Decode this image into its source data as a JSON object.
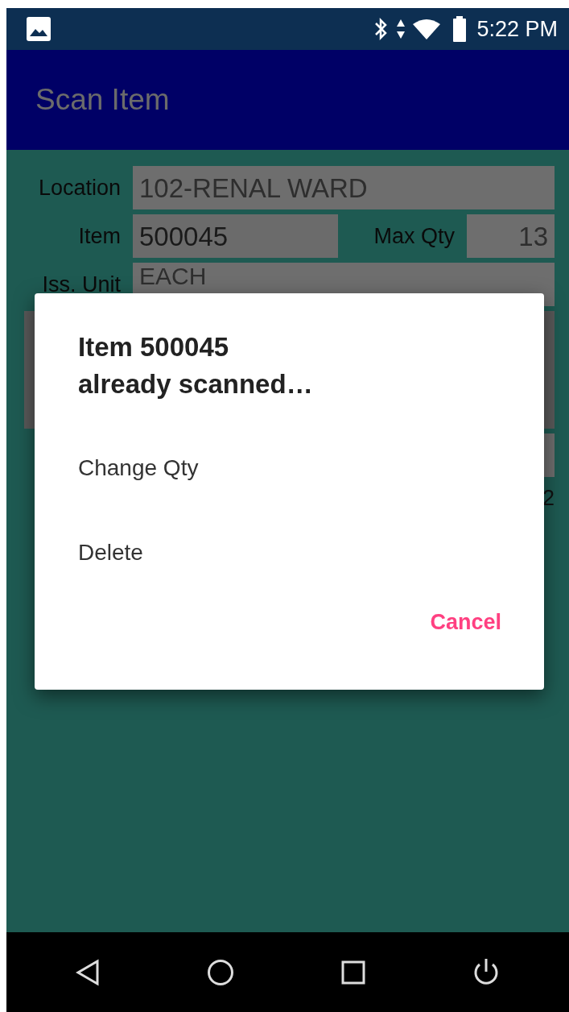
{
  "status_bar": {
    "time": "5:22 PM"
  },
  "app_bar": {
    "title": "Scan Item"
  },
  "form": {
    "location": {
      "label": "Location",
      "value": "102-RENAL WARD",
      "disabled": true
    },
    "item": {
      "label": "Item",
      "value": "500045",
      "disabled": false
    },
    "max_qty": {
      "label": "Max Qty",
      "value": "13",
      "disabled": true
    },
    "iss_unit": {
      "label": "Iss. Unit",
      "value": "EACH",
      "disabled": true
    },
    "column_text": "2"
  },
  "dialog": {
    "title_lines": [
      "Item 500045",
      "already scanned…"
    ],
    "options": [
      "Change Qty",
      "Delete"
    ],
    "buttons": [
      "Cancel"
    ]
  }
}
